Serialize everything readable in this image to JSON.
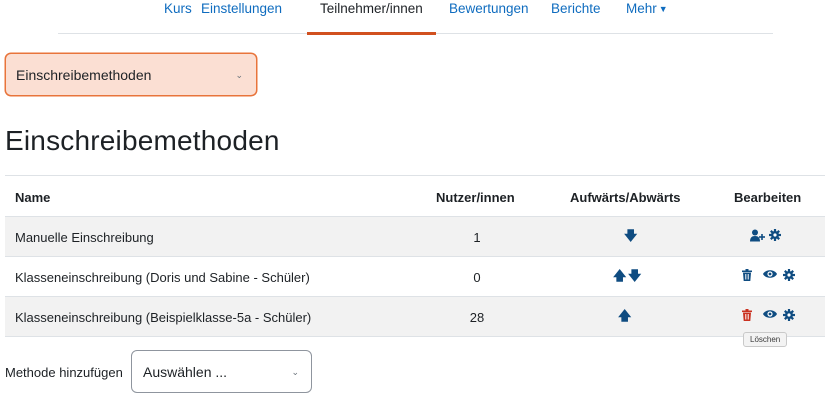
{
  "nav": {
    "tabs": [
      {
        "label": "Kurs"
      },
      {
        "label": "Einstellungen"
      },
      {
        "label": "Teilnehmer/innen",
        "active": true
      },
      {
        "label": "Bewertungen"
      },
      {
        "label": "Berichte"
      },
      {
        "label": "Mehr"
      }
    ]
  },
  "page_select": {
    "value": "Einschreibemethoden"
  },
  "page_title": "Einschreibemethoden",
  "table": {
    "headers": {
      "name": "Name",
      "users": "Nutzer/innen",
      "updown": "Aufwärts/Abwärts",
      "edit": "Bearbeiten"
    },
    "rows": [
      {
        "name": "Manuelle Einschreibung",
        "users": "1",
        "arrows": [
          "down"
        ],
        "edit_icons": [
          "enrol-users-icon",
          "gear-icon"
        ]
      },
      {
        "name": "Klasseneinschreibung (Doris und Sabine - Schüler)",
        "users": "0",
        "arrows": [
          "up",
          "down"
        ],
        "edit_icons": [
          "trash-icon",
          "eye-icon",
          "gear-icon"
        ]
      },
      {
        "name": "Klasseneinschreibung (Beispielklasse-5a - Schüler)",
        "users": "28",
        "arrows": [
          "up"
        ],
        "edit_icons": [
          "trash-icon",
          "eye-icon",
          "gear-icon"
        ]
      }
    ]
  },
  "tooltip": "Löschen",
  "add_method": {
    "label": "Methode hinzufügen",
    "select_value": "Auswählen ..."
  },
  "colors": {
    "link": "#0f6cbf",
    "accent": "#d1501f",
    "icon": "#0f4c81",
    "delete_hover": "#ca3120"
  }
}
